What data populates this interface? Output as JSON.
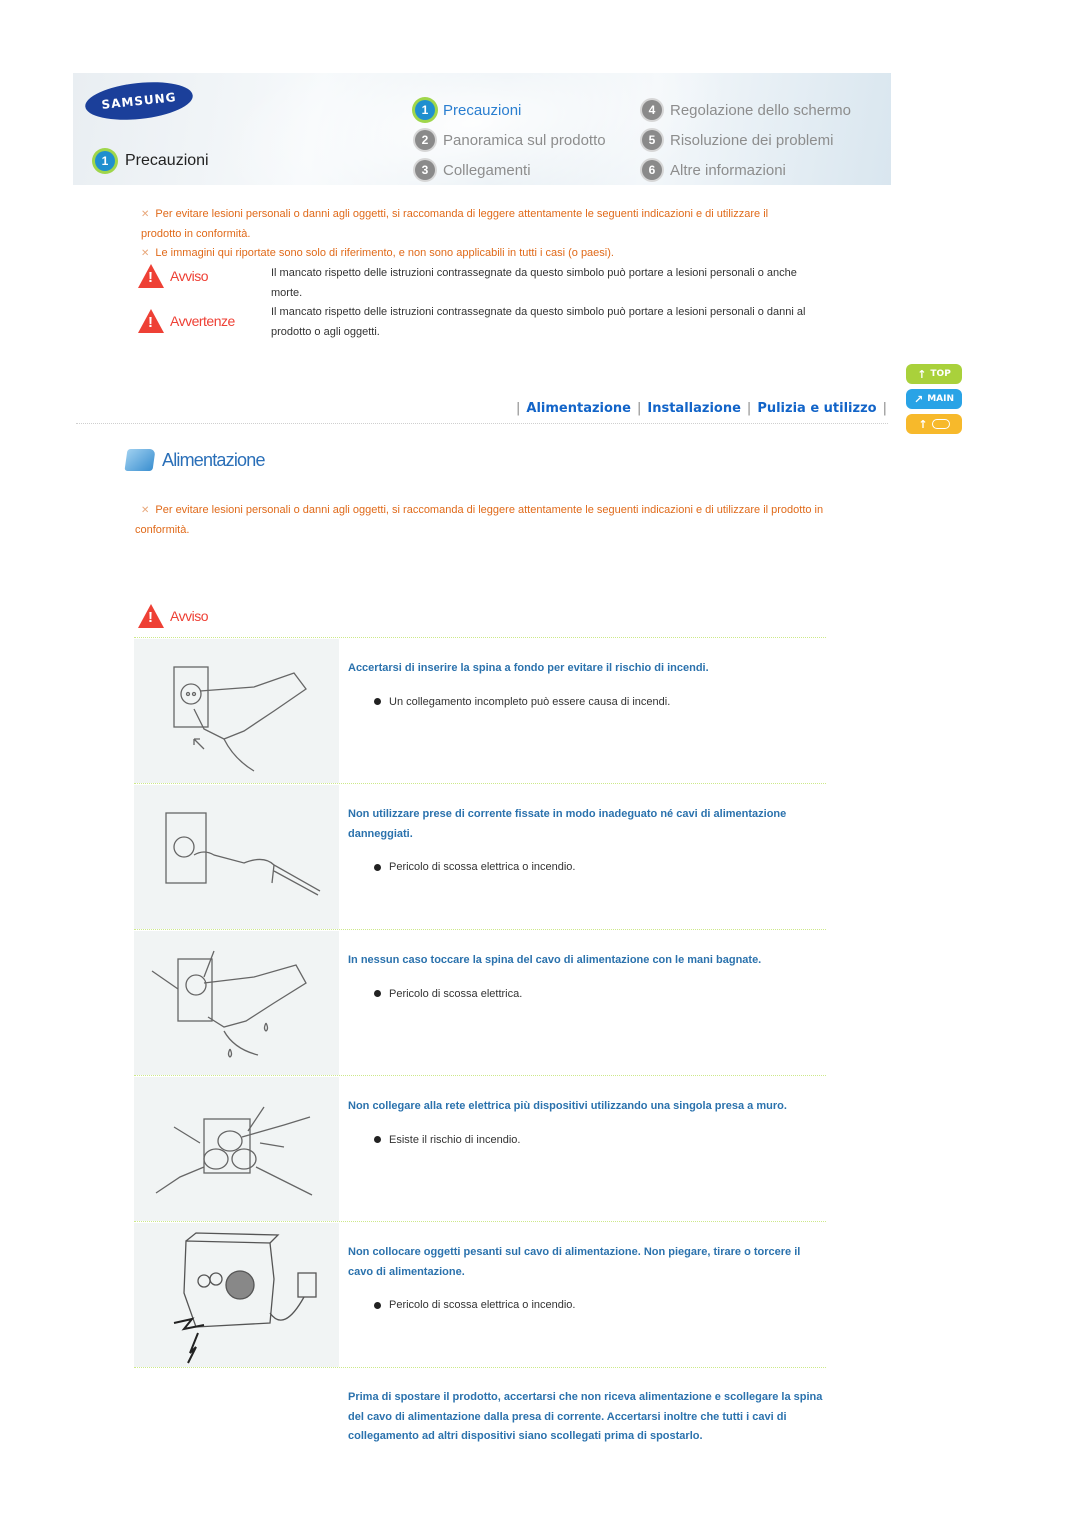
{
  "header": {
    "logo_text": "SAMSUNG",
    "current_section": {
      "number": "1",
      "label": "Precauzioni"
    },
    "menu": [
      {
        "number": "1",
        "label": "Precauzioni",
        "active": true
      },
      {
        "number": "2",
        "label": "Panoramica sul prodotto",
        "active": false
      },
      {
        "number": "3",
        "label": "Collegamenti",
        "active": false
      },
      {
        "number": "4",
        "label": "Regolazione dello schermo",
        "active": false
      },
      {
        "number": "5",
        "label": "Risoluzione dei problemi",
        "active": false
      },
      {
        "number": "6",
        "label": "Altre informazioni",
        "active": false
      }
    ]
  },
  "intro": {
    "notes": [
      "Per evitare lesioni personali o danni agli oggetti, si raccomanda di leggere attentamente le seguenti indicazioni e di utilizzare il prodotto in conformità.",
      "Le immagini qui riportate sono solo di riferimento, e non sono applicabili in tutti i casi (o paesi)."
    ],
    "warnings": [
      {
        "label": "Avviso",
        "text": "Il mancato rispetto delle istruzioni contrassegnate da questo simbolo può portare a lesioni personali o anche morte."
      },
      {
        "label": "Avvertenze",
        "text": "Il mancato rispetto delle istruzioni contrassegnate da questo simbolo può portare a lesioni personali o danni al prodotto o agli oggetti."
      }
    ]
  },
  "anchors": [
    "Alimentazione",
    "Installazione",
    "Pulizia e utilizzo"
  ],
  "side_buttons": {
    "top": "TOP",
    "main": "MAIN",
    "back": ""
  },
  "section": {
    "title": "Alimentazione",
    "note": "Per evitare lesioni personali o danni agli oggetti, si raccomanda di leggere attentamente le seguenti indicazioni e di utilizzare il prodotto in conformità.",
    "warning_label": "Avviso",
    "items": [
      {
        "title": "Accertarsi di inserire la spina a fondo per evitare il rischio di incendi.",
        "bullet": "Un collegamento incompleto può essere causa di incendi.",
        "image": "hand-plug-illustration"
      },
      {
        "title": "Non utilizzare prese di corrente fissate in modo inadeguato né cavi di alimentazione danneggiati.",
        "bullet": "Pericolo di scossa elettrica o incendio.",
        "image": "damaged-cord-illustration"
      },
      {
        "title": "In nessun caso toccare la spina del cavo di alimentazione con le mani bagnate.",
        "bullet": "Pericolo di scossa elettrica.",
        "image": "wet-hand-illustration"
      },
      {
        "title": "Non collegare alla rete elettrica più dispositivi utilizzando una singola presa a muro.",
        "bullet": "Esiste il rischio di incendio.",
        "image": "overloaded-socket-illustration"
      },
      {
        "title": "Non collocare oggetti pesanti sul cavo di alimentazione. Non piegare, tirare o torcere il cavo di alimentazione.",
        "bullet": "Pericolo di scossa elettrica o incendio.",
        "image": "heavy-object-cord-illustration"
      }
    ],
    "final_note": "Prima di spostare il prodotto, accertarsi che non riceva alimentazione e scollegare la spina del cavo di alimentazione dalla presa di corrente. Accertarsi inoltre che tutti i cavi di collegamento ad altri dispositivi siano scollegati prima di spostarlo."
  }
}
